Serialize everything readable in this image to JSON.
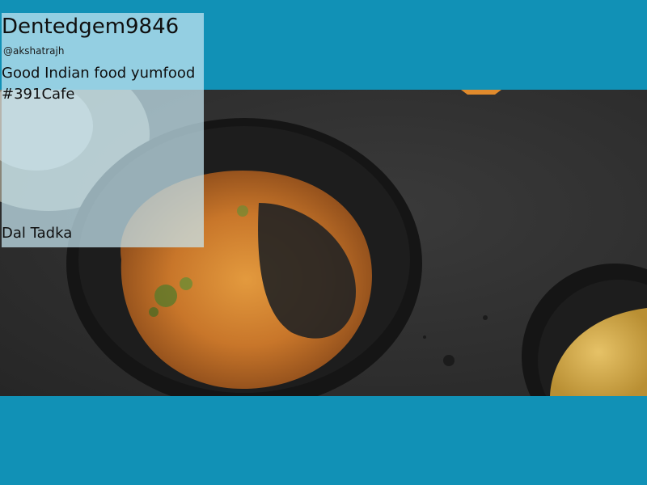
{
  "post": {
    "username": "Dentedgem9846",
    "handle": "@akshatrajh",
    "caption": "Good Indian food yumfood #391Cafe",
    "dish": "Dal Tadka"
  },
  "photo": {
    "subject": "food-photo",
    "colors": {
      "background": "#1191b6",
      "table": "#2f2f2f",
      "curry": "#c8762a",
      "bowl": "#151515",
      "rice": "#d9b24a"
    }
  }
}
